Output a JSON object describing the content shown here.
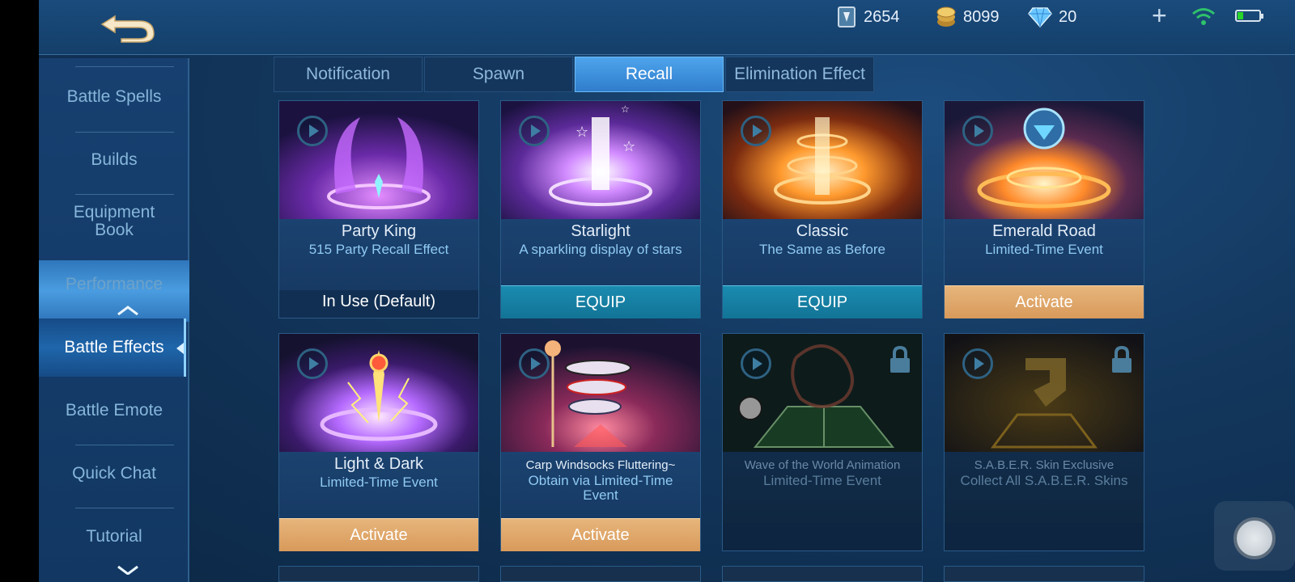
{
  "topbar": {
    "resources": [
      {
        "name": "tickets",
        "icon": "ticket-icon",
        "value": "2654"
      },
      {
        "name": "battle-points",
        "icon": "gold-coin-icon",
        "value": "8099"
      },
      {
        "name": "diamonds",
        "icon": "diamond-icon",
        "value": "20"
      }
    ]
  },
  "sidebar": {
    "items": [
      {
        "label": "Battle Spells"
      },
      {
        "label": "Builds"
      },
      {
        "label": "Equipment Book"
      },
      {
        "label": "Performance"
      },
      {
        "label": "Battle Effects"
      },
      {
        "label": "Battle Emote"
      },
      {
        "label": "Quick Chat"
      },
      {
        "label": "Tutorial"
      }
    ]
  },
  "tabs": [
    {
      "label": "Notification"
    },
    {
      "label": "Spawn"
    },
    {
      "label": "Recall"
    },
    {
      "label": "Elimination Effect"
    }
  ],
  "active_tab": "Recall",
  "cards": [
    {
      "name": "Party King",
      "desc": "515 Party Recall Effect",
      "button": "In Use (Default)"
    },
    {
      "name": "Starlight",
      "desc": "A sparkling display of stars",
      "button": "EQUIP"
    },
    {
      "name": "Classic",
      "desc": "The Same as Before",
      "button": "EQUIP"
    },
    {
      "name": "Emerald Road",
      "desc": "Limited-Time Event",
      "button": "Activate"
    },
    {
      "name": "Light & Dark",
      "desc": "Limited-Time Event",
      "button": "Activate"
    },
    {
      "name": "Carp Windsocks Fluttering~",
      "desc": "Obtain via Limited-Time Event",
      "button": "Activate"
    },
    {
      "name": "Wave of the World Animation",
      "desc": "Limited-Time Event"
    },
    {
      "name": "S.A.B.E.R. Skin Exclusive",
      "desc": "Collect All S.A.B.E.R. Skins"
    }
  ],
  "colors": {
    "equip": "#1a8bb0",
    "activate": "#e0a86a",
    "tab_active": "#3f92de",
    "background": "#13375d"
  }
}
